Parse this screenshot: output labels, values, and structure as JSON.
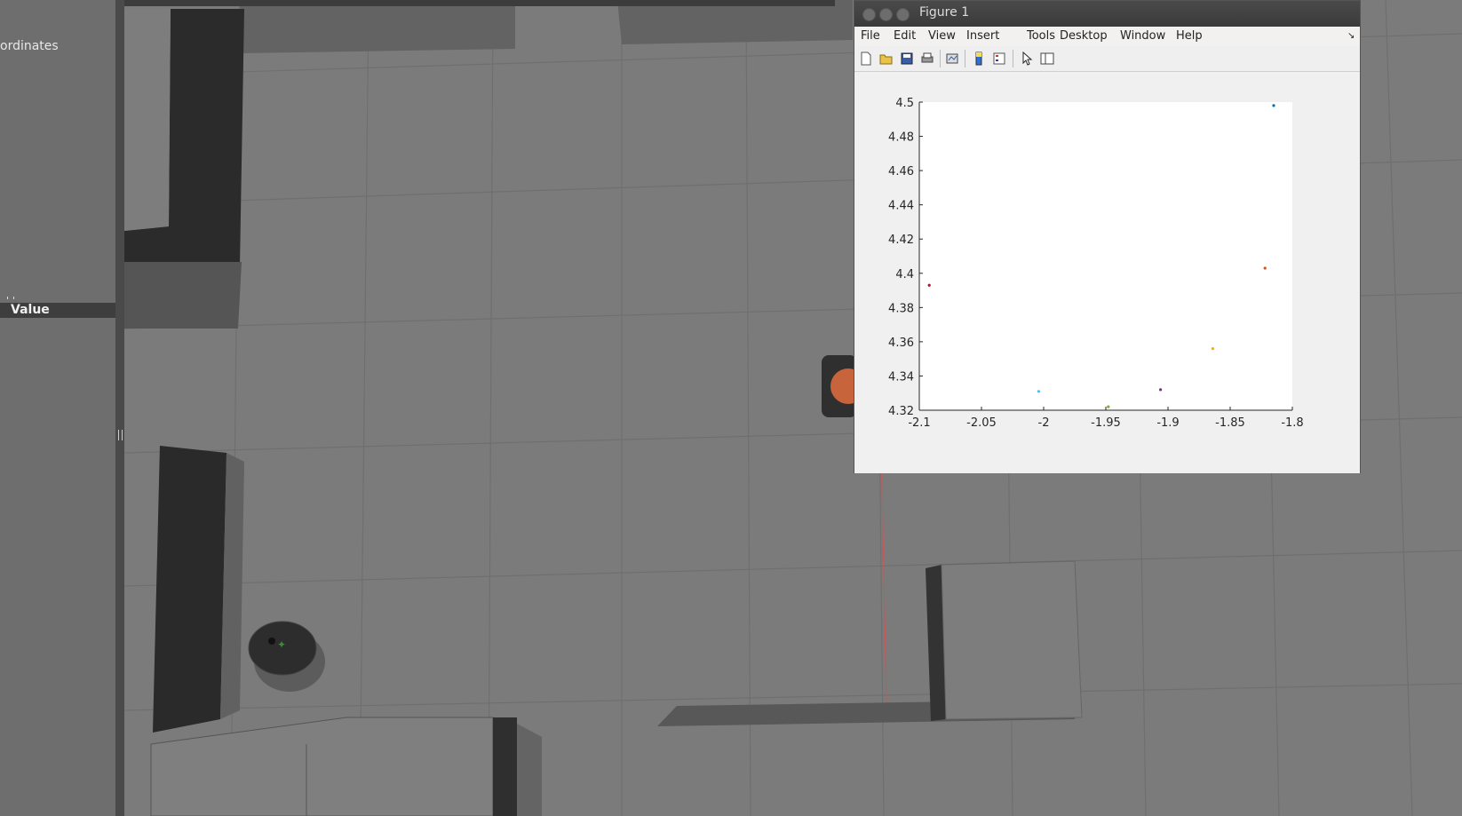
{
  "left_panel": {
    "coordinates_label": "ordinates",
    "value_header": "Value"
  },
  "figure": {
    "title": "Figure 1",
    "menu": [
      "File",
      "Edit",
      "View",
      "Insert",
      "Tools",
      "Desktop",
      "Window",
      "Help"
    ],
    "toolbar_icons": [
      "new-figure-icon",
      "open-file-icon",
      "save-icon",
      "print-icon",
      "link-plot-icon",
      "insert-colorbar-icon",
      "insert-legend-icon",
      "edit-plot-icon",
      "property-inspector-icon"
    ]
  },
  "chart_data": {
    "type": "scatter",
    "xlim": [
      -2.1,
      -1.8
    ],
    "ylim": [
      4.32,
      4.5
    ],
    "xticks": [
      "-2.1",
      "-2.05",
      "-2",
      "-1.95",
      "-1.9",
      "-1.85",
      "-1.8"
    ],
    "yticks": [
      "4.32",
      "4.34",
      "4.36",
      "4.38",
      "4.4",
      "4.42",
      "4.44",
      "4.46",
      "4.48",
      "4.5"
    ],
    "grid": false,
    "points": [
      {
        "x": -2.092,
        "y": 4.393,
        "color": "#a2142f"
      },
      {
        "x": -2.004,
        "y": 4.331,
        "color": "#4dbeee"
      },
      {
        "x": -1.948,
        "y": 4.322,
        "color": "#77ac30"
      },
      {
        "x": -1.906,
        "y": 4.332,
        "color": "#7e2f8e"
      },
      {
        "x": -1.864,
        "y": 4.356,
        "color": "#edb120"
      },
      {
        "x": -1.822,
        "y": 4.403,
        "color": "#d95319"
      },
      {
        "x": -1.815,
        "y": 4.498,
        "color": "#0072bd"
      }
    ]
  }
}
